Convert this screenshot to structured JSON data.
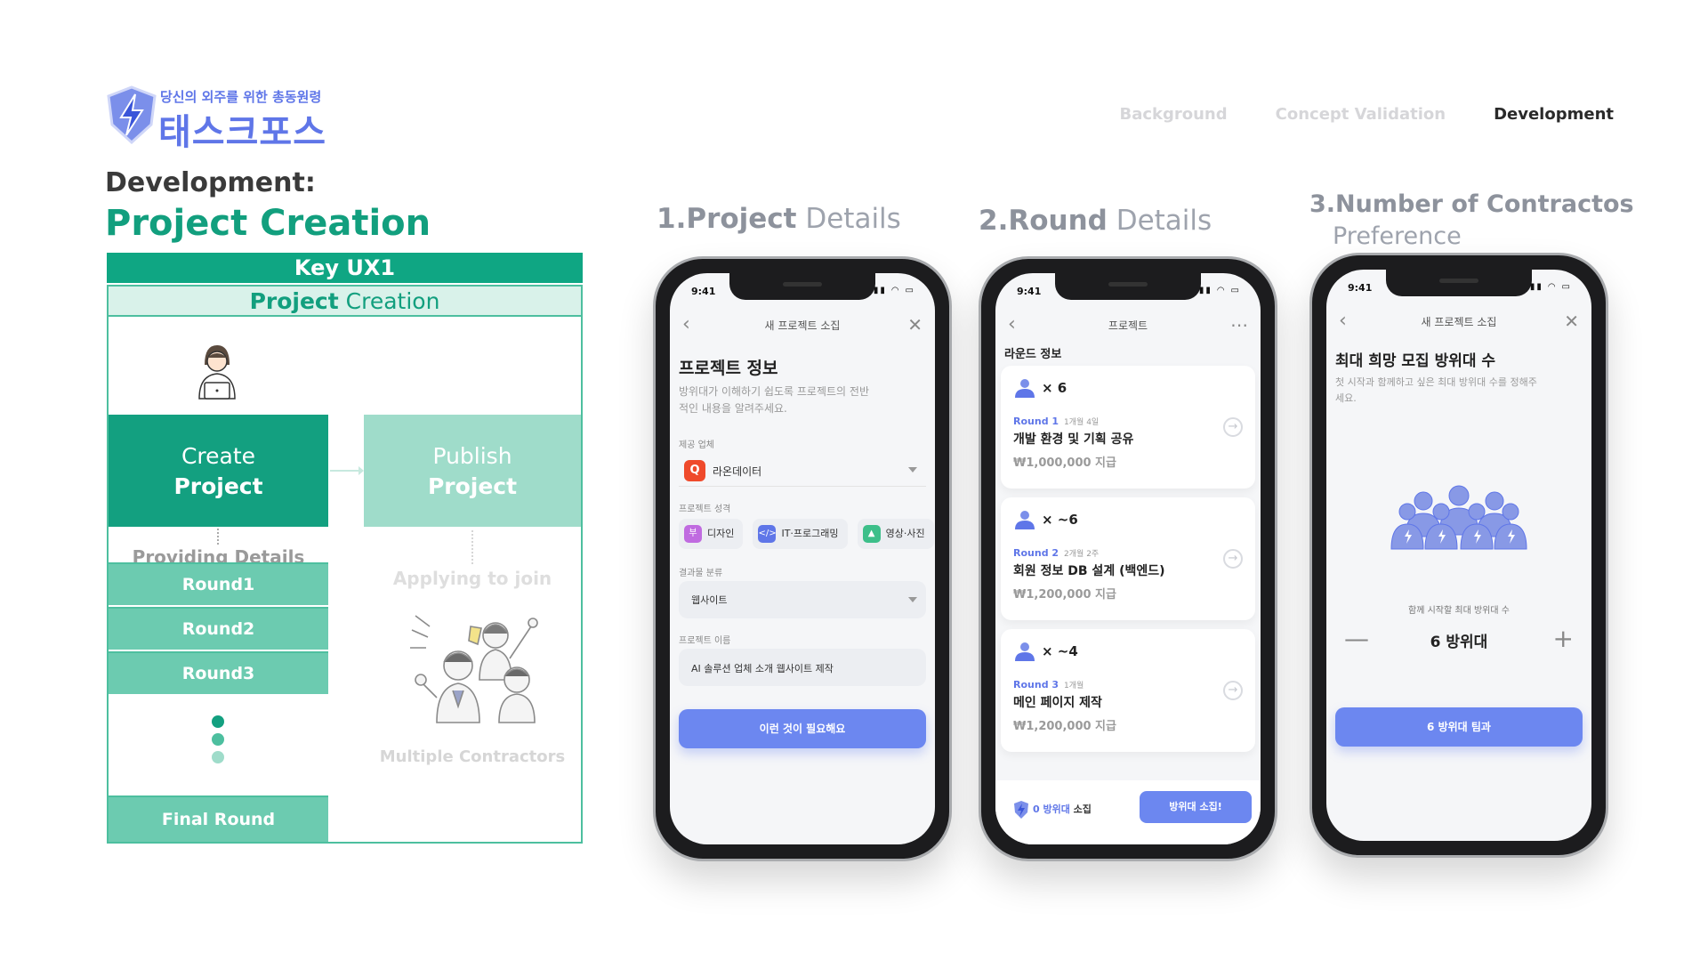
{
  "brand": {
    "tagline": "당신의 외주를 위한 총동원령",
    "name": "태스크포스"
  },
  "nav": [
    "Background",
    "Concept Validation",
    "Development"
  ],
  "header": {
    "label": "Development:",
    "title": "Project Creation"
  },
  "diagram": {
    "key": "Key UX1",
    "header_bold": "Project",
    "header_rest": " Creation",
    "create_l1": "Create",
    "create_l2": "Project",
    "publish_l1": "Publish",
    "publish_l2": "Project",
    "providing": "Providing Details",
    "applying": "Applying to join",
    "multiple": "Multiple Contractors",
    "rounds": [
      "Round1",
      "Round2",
      "Round3"
    ],
    "final": "Final Round"
  },
  "screen_headings": {
    "s1_bold": "1.Project",
    "s1_rest": " Details",
    "s2_bold": "2.Round",
    "s2_rest": " Details",
    "s3_line1": "3.Number of Contractos",
    "s3_line2": "Preference"
  },
  "phone1": {
    "time": "9:41",
    "topbar": "새 프로젝트 소집",
    "title": "프로젝트 정보",
    "desc": "방위대가 이해하기 쉽도록 프로젝트의 전반적인 내용을 알려주세요.",
    "company_label": "제공 업체",
    "company_logo": "Q",
    "company": "라온데이터",
    "type_label": "프로젝트 성격",
    "chips": [
      {
        "icon": "부",
        "label": "디자인",
        "color": "#c06be0"
      },
      {
        "icon": "</>",
        "label": "IT·프로그래밍",
        "color": "#5f76e8"
      },
      {
        "icon": "▲",
        "label": "영상·사진",
        "color": "#3dbf8a"
      }
    ],
    "result_label": "결과물 분류",
    "result": "웹사이트",
    "name_label": "프로젝트 이름",
    "name": "AI 솔루션 업체 소개 웹사이트 제작",
    "cta": "이런 것이 필요해요"
  },
  "phone2": {
    "time": "9:41",
    "topbar": "프로젝트",
    "section": "라운드 정보",
    "cards": [
      {
        "count": "× 6",
        "round": "Round 1",
        "duration": "1개월 4일",
        "name": "개발 환경 및 기획 공유",
        "price": "₩1,000,000 지급"
      },
      {
        "count": "× ~6",
        "round": "Round 2",
        "duration": "2개월 2주",
        "name": "회원 정보 DB 설계 (백엔드)",
        "price": "₩1,200,000 지급"
      },
      {
        "count": "× ~4",
        "round": "Round 3",
        "duration": "1개월",
        "name": "메인 페이지 제작",
        "price": "₩1,200,000 지급"
      }
    ],
    "bottom_count": "0 방위대",
    "bottom_suffix": " 소집",
    "bottom_button": "방위대 소집!"
  },
  "phone3": {
    "time": "9:41",
    "topbar": "새 프로젝트 소집",
    "title": "최대 희망 모집 방위대 수",
    "desc": "첫 시작과 함께하고 싶은 최대 방위대 수를 정해주세요.",
    "stepper_label": "함께 시작할 최대 방위대 수",
    "value": "6 방위대",
    "cta": "6 방위대 팀과"
  },
  "colors": {
    "accent": "#129f7e",
    "brand_blue": "#5f76e8",
    "cta_blue": "#6c87f0"
  }
}
